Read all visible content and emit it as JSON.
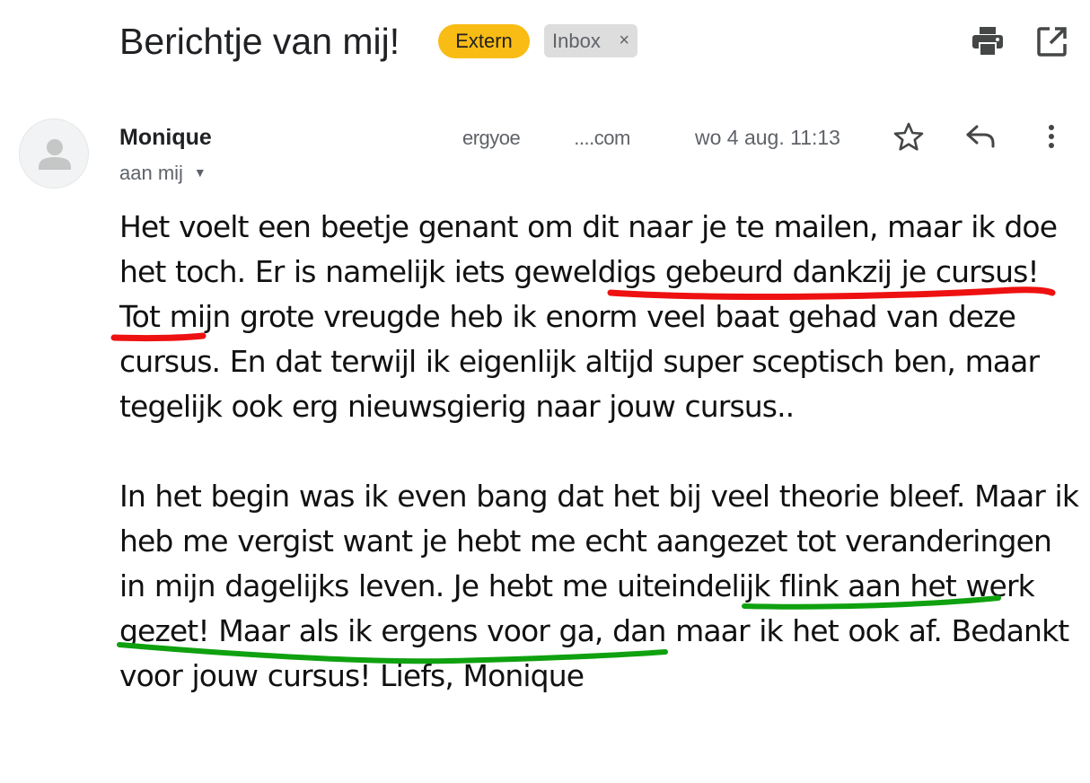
{
  "header": {
    "subject": "Berichtje van mij!",
    "labels": {
      "extern": "Extern",
      "inbox": "Inbox",
      "remove_symbol": "×"
    },
    "actions": {
      "print": "print-icon",
      "open_new_window": "open-in-new-window-icon"
    }
  },
  "message": {
    "sender_name": "Monique",
    "sender_email_fragment": "ergyoe",
    "sender_email_end": "....com",
    "date": "wo 4 aug. 11:13",
    "recipient": "aan mij",
    "actions": {
      "star": "star-icon",
      "reply": "reply-icon",
      "more": "more-vert-icon"
    },
    "paragraphs": [
      [
        {
          "text": "Het voelt een beetje genant om dit naar je te mailen, maar ik doe het toch. Er is namelijk iets "
        },
        {
          "text": "geweldigs gebeurd dankzij je cursus",
          "highlight": "red"
        },
        {
          "text": "! Tot mijn grote vreugde heb ik enorm veel baat gehad van deze cursus. En dat terwijl ik eigenlijk altijd super sceptisch ben, maar tegelijk ook erg nieuwsgierig naar jouw cursus.."
        }
      ],
      [
        {
          "text": "In het begin was ik even bang dat het bij veel theorie bleef. Maar ik heb me vergist want je hebt me e"
        },
        {
          "text": "cht aangezet tot veranderingen in mijn dagelijks leven",
          "highlight": "green"
        },
        {
          "text": ". Je hebt me uiteindelijk flink aan het werk gezet! Maar als ik ergens voor ga, dan maar ik het ook af. Bedankt voor jouw cursus! Liefs, Monique"
        }
      ]
    ]
  },
  "colors": {
    "extern_label": "#f9bc15",
    "inbox_label": "#dddddd",
    "red_highlight": "#ee1111",
    "green_highlight": "#0fa10f"
  }
}
